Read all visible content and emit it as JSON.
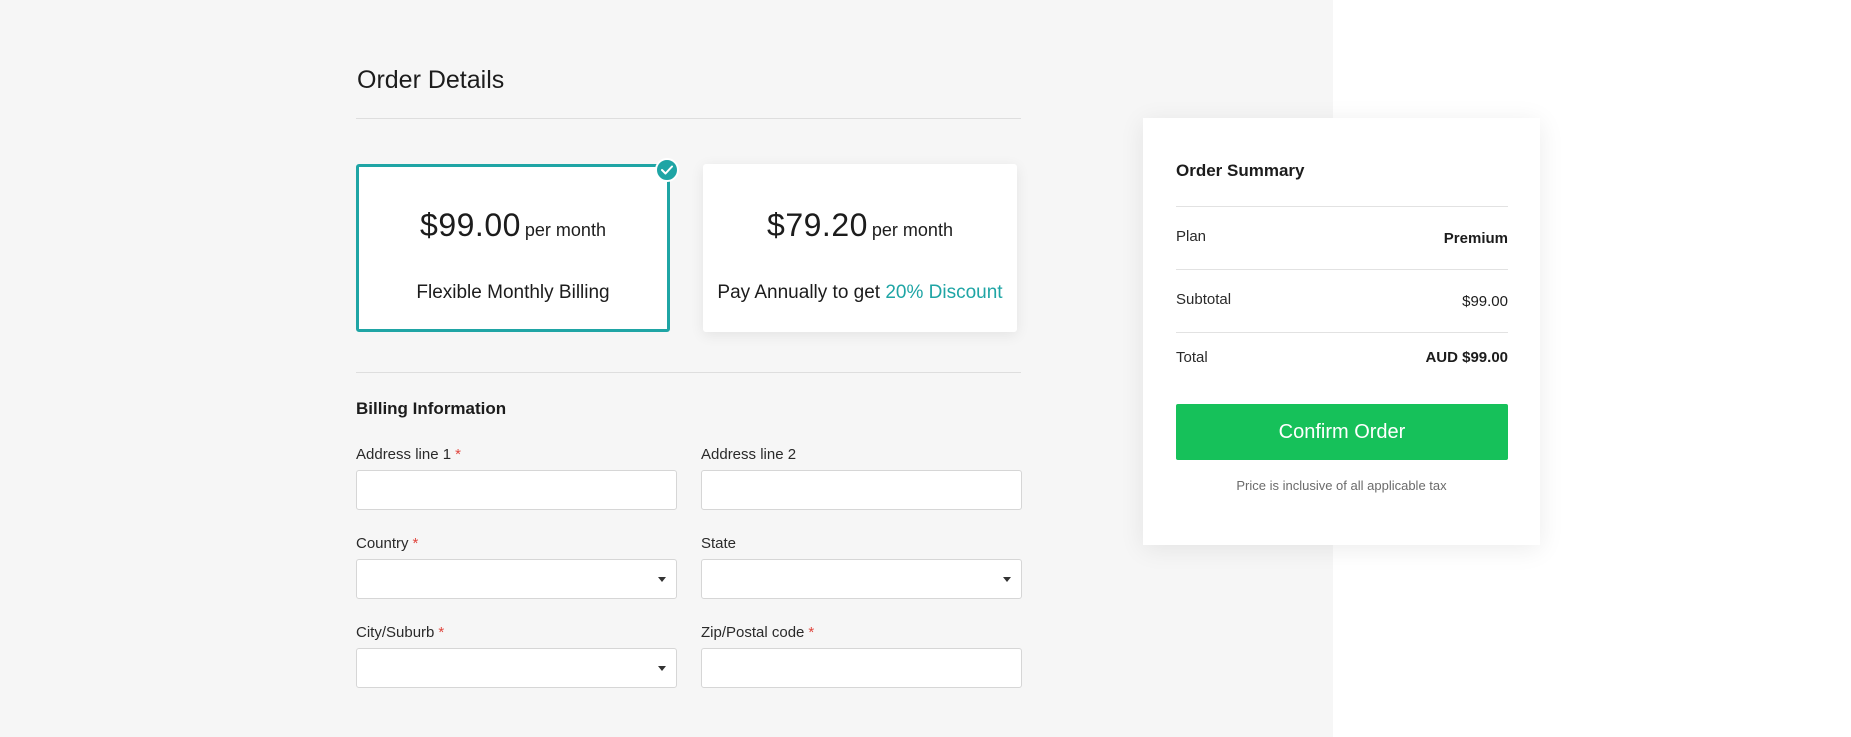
{
  "page": {
    "title": "Order Details"
  },
  "plans": [
    {
      "price": "$99.00",
      "period": "per month",
      "description": "Flexible Monthly Billing",
      "selected": true
    },
    {
      "price": "$79.20",
      "period": "per month",
      "description_prefix": "Pay Annually to get",
      "description_highlight": "20% Discount",
      "selected": false
    }
  ],
  "billing": {
    "title": "Billing Information",
    "required_marker": "*",
    "fields": {
      "address1": {
        "label": "Address line 1",
        "value": "",
        "required": true
      },
      "address2": {
        "label": "Address line 2",
        "value": "",
        "required": false
      },
      "country": {
        "label": "Country",
        "value": "",
        "required": true
      },
      "state": {
        "label": "State",
        "value": "",
        "required": false
      },
      "city": {
        "label": "City/Suburb",
        "value": "",
        "required": true
      },
      "zip": {
        "label": "Zip/Postal code",
        "value": "",
        "required": true
      }
    }
  },
  "summary": {
    "title": "Order Summary",
    "plan_label": "Plan",
    "plan_value": "Premium",
    "subtotal_label": "Subtotal",
    "subtotal_value": "$99.00",
    "total_label": "Total",
    "total_value": "AUD $99.00",
    "confirm_label": "Confirm Order",
    "tax_note": "Price is inclusive of all applicable tax"
  },
  "colors": {
    "accent": "#1fa5a5",
    "confirm_button": "#16c15a",
    "required": "#e0463e",
    "left_background": "#f6f6f6"
  },
  "icons": {
    "selected_badge": "check-icon",
    "select_caret": "caret-down-icon"
  }
}
